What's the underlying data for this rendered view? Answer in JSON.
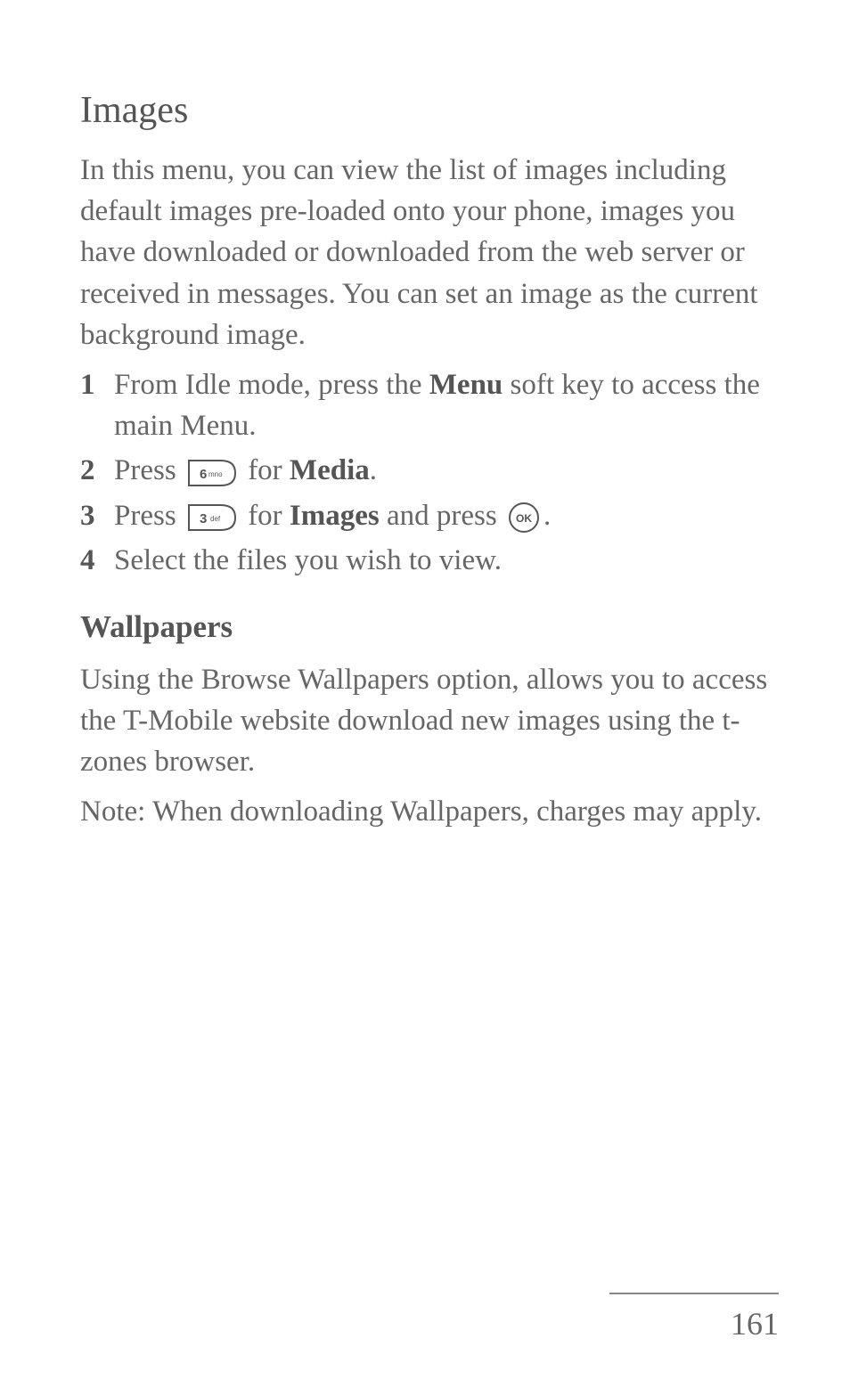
{
  "section1": {
    "heading": "Images",
    "intro": "In this menu, you can view the list of images including default images pre-loaded onto your phone, images you have downloaded or downloaded from the web server or received in messages. You can set an image as the current background image.",
    "steps": [
      {
        "num": "1",
        "pre": "From Idle mode, press the ",
        "bold1": "Menu",
        "post": " soft key to access the main Menu."
      },
      {
        "num": "2",
        "pre": "Press ",
        "icon": "key-6",
        "mid": " for ",
        "bold1": "Media",
        "post": "."
      },
      {
        "num": "3",
        "pre": "Press ",
        "icon": "key-3",
        "mid": " for ",
        "bold1": "Images",
        "mid2": " and press ",
        "icon2": "key-ok",
        "post": "."
      },
      {
        "num": "4",
        "pre": "Select the files you wish to view."
      }
    ]
  },
  "section2": {
    "heading": "Wallpapers",
    "para1": "Using the Browse Wallpapers option, allows you to access the T-Mobile website download new images using the t-zones browser.",
    "para2": "Note: When downloading Wallpapers, charges may apply."
  },
  "pageNumber": "161",
  "icons": {
    "key6_label": "6 mno",
    "key3_label": "3 def",
    "ok_label": "OK"
  }
}
